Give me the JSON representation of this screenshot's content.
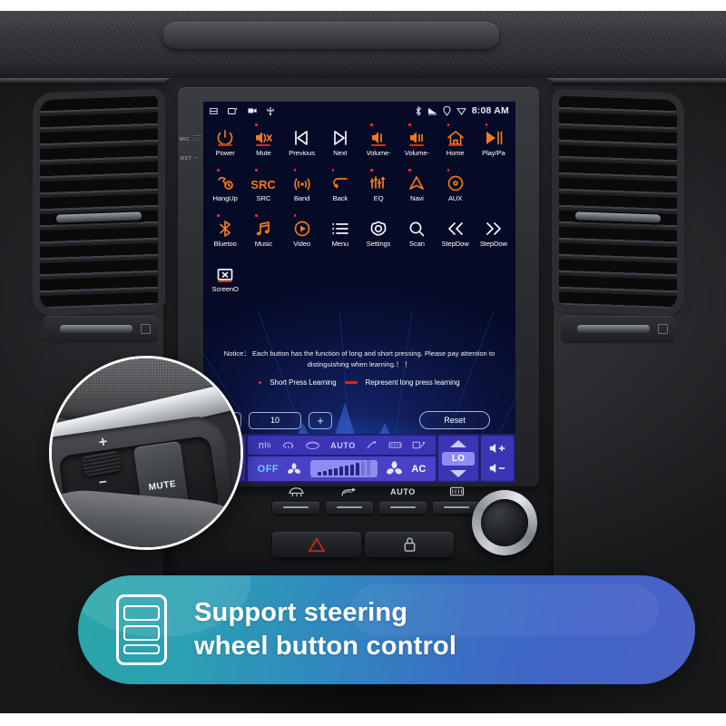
{
  "screen": {
    "statusbar": {
      "left_icons": [
        "save-icon",
        "window-icon",
        "camera-icon",
        "usb-icon"
      ],
      "right_icons": [
        "bluetooth-icon",
        "cast-icon",
        "location-icon",
        "wifi-icon"
      ],
      "time": "8:08 AM"
    },
    "functions": [
      {
        "label": "Power",
        "icon": "power-icon",
        "dot": false,
        "bar": true,
        "color": "orange"
      },
      {
        "label": "Mute",
        "icon": "mute-icon",
        "dot": true,
        "bar": true,
        "color": "orange"
      },
      {
        "label": "Previous",
        "icon": "previous-icon",
        "dot": false,
        "bar": false,
        "color": "white"
      },
      {
        "label": "Next",
        "icon": "next-icon",
        "dot": false,
        "bar": false,
        "color": "white"
      },
      {
        "label": "Volume-",
        "icon": "volume-up-icon",
        "dot": true,
        "bar": true,
        "color": "orange"
      },
      {
        "label": "Volume-",
        "icon": "volume-down-icon",
        "dot": true,
        "bar": true,
        "color": "orange"
      },
      {
        "label": "Home",
        "icon": "home-icon",
        "dot": true,
        "bar": true,
        "color": "orange"
      },
      {
        "label": "Play/Pa",
        "icon": "play-pause-icon",
        "dot": true,
        "bar": false,
        "color": "orange"
      },
      {
        "label": "HangUp",
        "icon": "hangup-icon",
        "dot": true,
        "bar": false,
        "color": "orange"
      },
      {
        "label": "SRC",
        "icon": "src-icon",
        "dot": true,
        "bar": false,
        "color": "orange"
      },
      {
        "label": "Band",
        "icon": "band-icon",
        "dot": true,
        "bar": false,
        "color": "orange"
      },
      {
        "label": "Back",
        "icon": "back-icon",
        "dot": true,
        "bar": false,
        "color": "orange"
      },
      {
        "label": "EQ",
        "icon": "eq-icon",
        "dot": true,
        "bar": false,
        "color": "orange"
      },
      {
        "label": "Navi",
        "icon": "navi-icon",
        "dot": true,
        "bar": false,
        "color": "orange"
      },
      {
        "label": "AUX",
        "icon": "aux-icon",
        "dot": true,
        "bar": false,
        "color": "orange"
      },
      {
        "label": "",
        "icon": "empty-icon",
        "dot": false,
        "bar": false,
        "color": "orange"
      },
      {
        "label": "Bluetoo",
        "icon": "bluetooth-icon",
        "dot": true,
        "bar": false,
        "color": "orange"
      },
      {
        "label": "Music",
        "icon": "music-icon",
        "dot": true,
        "bar": false,
        "color": "orange"
      },
      {
        "label": "Video",
        "icon": "video-icon",
        "dot": true,
        "bar": false,
        "color": "orange"
      },
      {
        "label": "Menu",
        "icon": "menu-icon",
        "dot": false,
        "bar": false,
        "color": "white"
      },
      {
        "label": "Settings",
        "icon": "settings-icon",
        "dot": false,
        "bar": false,
        "color": "white"
      },
      {
        "label": "Scan",
        "icon": "search-icon",
        "dot": false,
        "bar": false,
        "color": "white"
      },
      {
        "label": "StepDow",
        "icon": "step-back-icon",
        "dot": false,
        "bar": false,
        "color": "white"
      },
      {
        "label": "StepDow",
        "icon": "step-fwd-icon",
        "dot": false,
        "bar": false,
        "color": "white"
      },
      {
        "label": "ScreenO",
        "icon": "screen-off-icon",
        "dot": false,
        "bar": true,
        "color": "white"
      }
    ],
    "notice": "Notice： Each button has the function of long and short pressing. Please pay attention to distinguishing when learning.！ ！",
    "legend": {
      "short": "Short Press Learning",
      "long": "Represent long press learning"
    },
    "stepper": {
      "minus": "−",
      "value": "10",
      "plus": "+",
      "reset": "Reset"
    },
    "colors": {
      "accent_orange": "#ef7a1a",
      "short_press_dot": "#ff2a2a",
      "long_press_bar": "#d03018",
      "screen_bg": "#070b2a"
    }
  },
  "climate": {
    "left": {
      "temp": "LO",
      "up": "arrow-up-icon",
      "down": "arrow-down-icon"
    },
    "right": {
      "temp": "LO",
      "up": "arrow-up-icon",
      "down": "arrow-down-icon"
    },
    "mode_icons": [
      "seat-heat-icon",
      "defrost-front-icon",
      "recirculate-icon",
      "airflow-up-icon",
      "airflow-face-icon",
      "airflow-feet-icon"
    ],
    "auto_label": "AUTO",
    "off_label": "OFF",
    "ac_label": "AC",
    "fan_level": 8,
    "fan_max": 10,
    "volume_up": "+",
    "volume_down": "−"
  },
  "dashboard": {
    "bezel_labels": [
      "MIC",
      "RST"
    ],
    "hvac_buttons": [
      "defrost-front-icon",
      "recirculate-icon",
      "AUTO",
      "defrost-rear-icon"
    ],
    "lower_buttons": [
      "hazard-icon",
      "lock-icon"
    ]
  },
  "inset": {
    "mute_label": "MUTE",
    "plus_label": "+",
    "minus_label": "−"
  },
  "banner": {
    "icon": "steering-wheel-buttons-icon",
    "line1": "Support steering",
    "line2": "wheel button control",
    "color_start": "#2aa6a6",
    "color_end": "#4a63c6"
  }
}
